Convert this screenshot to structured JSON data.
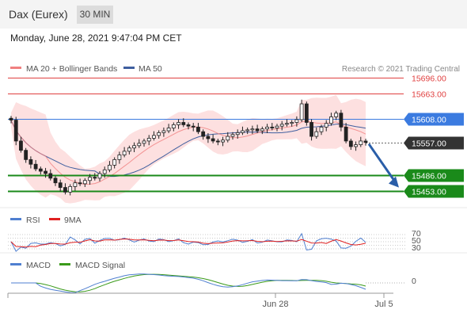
{
  "header": {
    "symbol": "Dax (Eurex)",
    "timeframe": "30 MIN",
    "datetime": "Monday, June 28, 2021 9:47:04 PM CET"
  },
  "chart_data": {
    "type": "candlestick",
    "copyright": "Research © 2021 Trading Central",
    "legend": [
      {
        "label": "MA 20 + Bollinger Bands",
        "color": "#f08080"
      },
      {
        "label": "MA 50",
        "color": "#3f5f9f"
      }
    ],
    "y_range": [
      15420,
      15710
    ],
    "price_levels": [
      {
        "label": "15696.00",
        "value": 15696,
        "kind": "resistance",
        "color": "#e04040"
      },
      {
        "label": "15663.00",
        "value": 15663,
        "kind": "resistance",
        "color": "#e04040"
      },
      {
        "label": "15608.00",
        "value": 15608,
        "kind": "pivot",
        "color": "#3b7be0"
      },
      {
        "label": "15557.00",
        "value": 15557,
        "kind": "last",
        "color": "#333333"
      },
      {
        "label": "15486.00",
        "value": 15486,
        "kind": "support",
        "color": "#1a8a1a"
      },
      {
        "label": "15453.00",
        "value": 15453,
        "kind": "support",
        "color": "#1a8a1a"
      }
    ],
    "forecast_arrow": {
      "from": 15557,
      "to": 15453,
      "direction": "down",
      "color": "#2a5ea8"
    },
    "x_ticks": [
      "Jun 28",
      "Jul 5"
    ],
    "price_series": [
      15605,
      15560,
      15540,
      15520,
      15510,
      15500,
      15495,
      15490,
      15480,
      15470,
      15460,
      15450,
      15462,
      15470,
      15468,
      15475,
      15482,
      15480,
      15490,
      15498,
      15508,
      15520,
      15530,
      15538,
      15545,
      15550,
      15555,
      15560,
      15566,
      15572,
      15578,
      15582,
      15588,
      15595,
      15600,
      15595,
      15592,
      15590,
      15580,
      15570,
      15565,
      15560,
      15558,
      15562,
      15570,
      15574,
      15578,
      15582,
      15584,
      15586,
      15582,
      15586,
      15590,
      15588,
      15592,
      15596,
      15598,
      15600,
      15606,
      15640,
      15600,
      15570,
      15580,
      15590,
      15598,
      15612,
      15620,
      15590,
      15560,
      15548,
      15552,
      15560,
      15557
    ],
    "rsi": {
      "label": "RSI",
      "color": "#4f7fd0",
      "ma_label": "9MA",
      "ma_color": "#e02020",
      "levels": [
        70,
        50,
        30
      ]
    },
    "macd": {
      "label": "MACD",
      "color": "#4f7fd0",
      "signal_label": "MACD Signal",
      "signal_color": "#3a9a1a",
      "level": 0
    }
  }
}
